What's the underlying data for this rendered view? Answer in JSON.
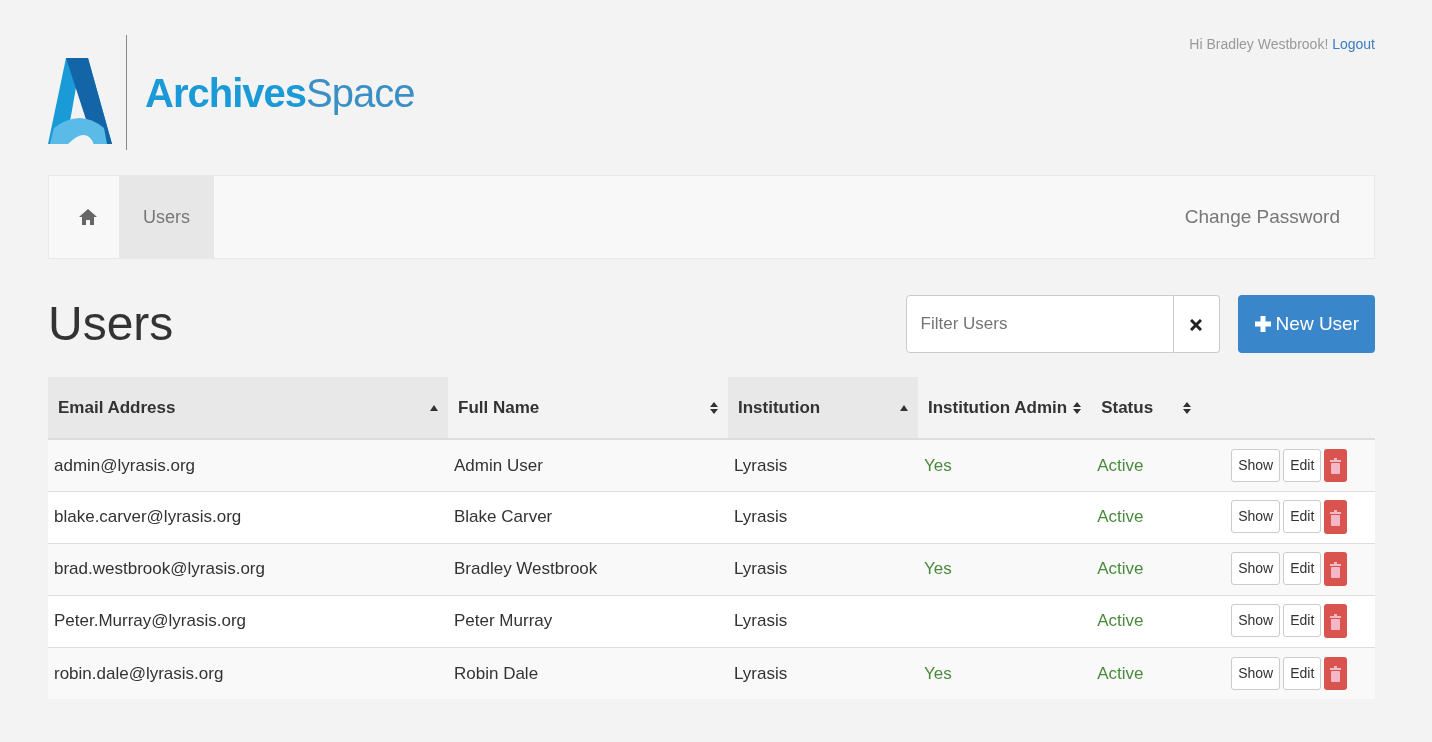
{
  "brand": {
    "bold": "Archives",
    "light": "Space"
  },
  "user_greeting": "Hi Bradley Westbrook!",
  "logout": "Logout",
  "breadcrumb": [
    {
      "label": "Users",
      "selected": true
    }
  ],
  "nav_link": "Change Password",
  "page_title": "Users",
  "filter": {
    "placeholder": "Filter Users"
  },
  "new_button": "New User",
  "table": {
    "columns": [
      {
        "label": "Email Address",
        "sorted": true
      },
      {
        "label": "Full Name",
        "sorted": false
      },
      {
        "label": "Institution",
        "sorted": true
      },
      {
        "label": "Institution Admin",
        "sorted": false
      },
      {
        "label": "Status",
        "sorted": false
      }
    ],
    "rows": [
      {
        "email": "admin@lyrasis.org",
        "name": "Admin User",
        "institution": "Lyrasis",
        "admin": "Yes",
        "status": "Active",
        "show": "Show",
        "edit": "Edit"
      },
      {
        "email": "blake.carver@lyrasis.org",
        "name": "Blake Carver",
        "institution": "Lyrasis",
        "status": "Active",
        "show": "Show",
        "edit": "Edit"
      },
      {
        "email": "brad.westbrook@lyrasis.org",
        "name": "Bradley Westbrook",
        "institution": "Lyrasis",
        "admin": "Yes",
        "status": "Active",
        "show": "Show",
        "edit": "Edit"
      },
      {
        "email": "Peter.Murray@lyrasis.org",
        "name": "Peter Murray",
        "institution": "Lyrasis",
        "status": "Active",
        "show": "Show",
        "edit": "Edit"
      },
      {
        "email": "robin.dale@lyrasis.org",
        "name": "Robin Dale",
        "institution": "Lyrasis",
        "admin": "Yes",
        "status": "Active",
        "show": "Show",
        "edit": "Edit"
      }
    ]
  }
}
